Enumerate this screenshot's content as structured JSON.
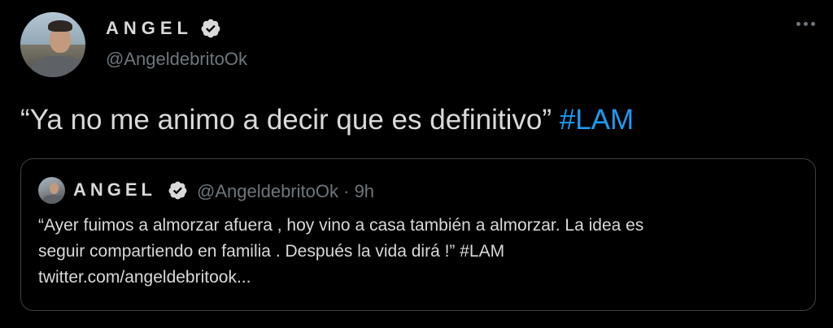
{
  "author": {
    "name": "ANGEL",
    "handle": "@AngeldebritoOk",
    "verified": true
  },
  "tweet": {
    "text": "“Ya no me animo a decir que es definitivo” ",
    "hashtag": "#LAM"
  },
  "quoted": {
    "name": "ANGEL",
    "handle": "@AngeldebritoOk",
    "separator": "·",
    "time": "9h",
    "lines": [
      "“Ayer fuimos a almorzar afuera , hoy vino a casa también a almorzar. La idea es",
      "seguir compartiendo en familia . Después la vida dirá !” #LAM",
      "twitter.com/angeldebritook..."
    ]
  },
  "colors": {
    "background": "#000000",
    "text": "#d9d9d9",
    "secondary": "#6e767d",
    "accent": "#1d9bf0",
    "border": "#3d4144"
  },
  "icons": {
    "verified": "verified-badge-icon",
    "more": "more-horizontal-icon"
  }
}
